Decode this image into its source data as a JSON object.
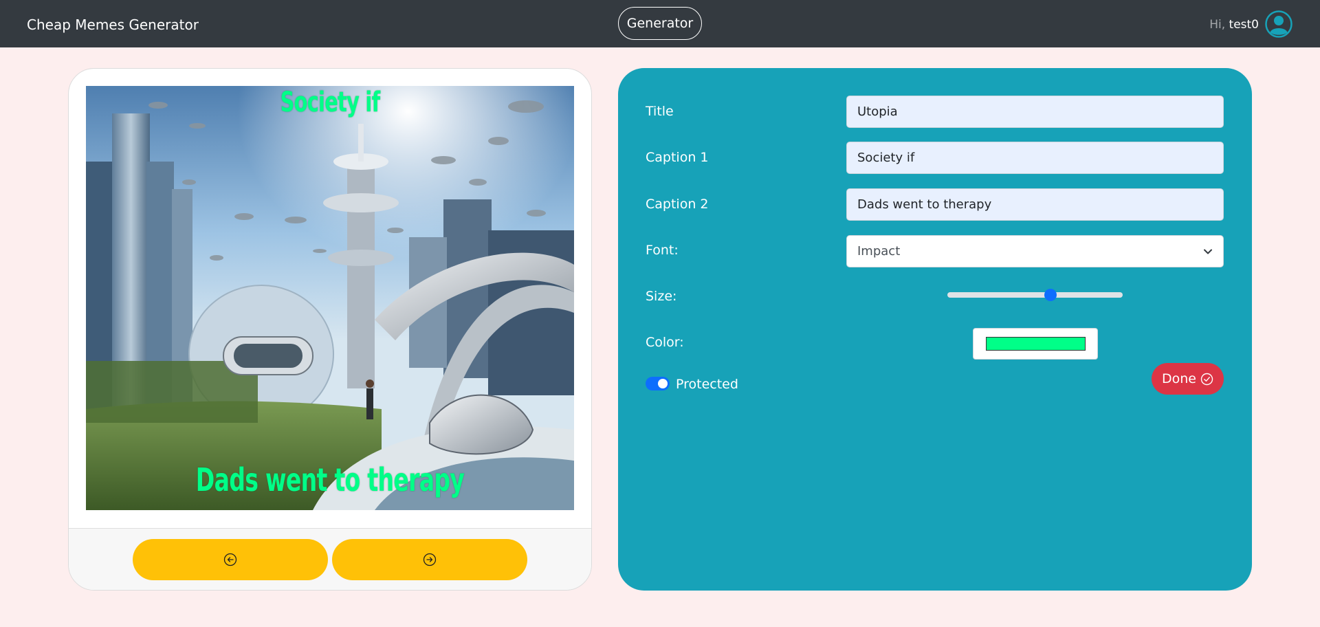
{
  "navbar": {
    "brand": "Cheap Memes Generator",
    "center_button": "Generator",
    "greeting_prefix": "Hi,",
    "username": "test0",
    "avatar_icon": "user-circle-icon"
  },
  "meme": {
    "caption_top": "Society if",
    "caption_bottom": "Dads went to therapy",
    "image_subject": "futuristic utopian city with monorail, flying vehicles and park",
    "caption_color": "#00ff88"
  },
  "meme_nav": {
    "prev_icon": "arrow-left-circle-icon",
    "next_icon": "arrow-right-circle-icon"
  },
  "form": {
    "title_label": "Title",
    "title_value": "Utopia",
    "caption1_label": "Caption 1",
    "caption1_value": "Society if",
    "caption2_label": "Caption 2",
    "caption2_value": "Dads went to therapy",
    "font_label": "Font:",
    "font_value": "Impact",
    "size_label": "Size:",
    "size_value_fraction": 0.59,
    "color_label": "Color:",
    "color_value": "#00ff88",
    "protected_label": "Protected",
    "protected_checked": true,
    "done_label": "Done",
    "done_icon": "check-circle-icon"
  },
  "colors": {
    "navbar": "#343a40",
    "page_background": "#fdeeee",
    "panel": "#17a2b8",
    "nav_arrow_buttons": "#ffc107",
    "done_button": "#dc3545",
    "toggle_accent": "#0d6efd"
  }
}
